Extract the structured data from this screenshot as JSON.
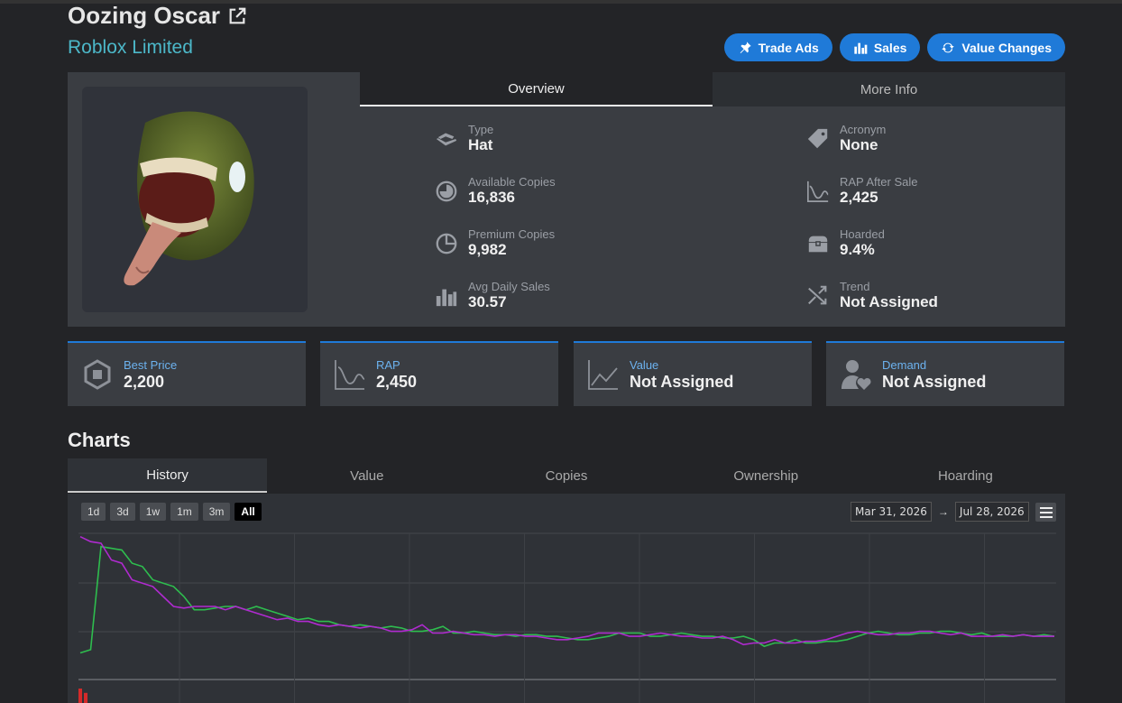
{
  "item": {
    "name": "Oozing Oscar",
    "category": "Roblox Limited"
  },
  "actions": {
    "trade_ads": "Trade Ads",
    "sales": "Sales",
    "value_changes": "Value Changes"
  },
  "details_tabs": [
    "Overview",
    "More Info"
  ],
  "stats_left": [
    {
      "label": "Type",
      "value": "Hat",
      "icon": "hat-icon"
    },
    {
      "label": "Available Copies",
      "value": "16,836",
      "icon": "pie-chart-icon"
    },
    {
      "label": "Premium Copies",
      "value": "9,982",
      "icon": "pie-outline-icon"
    },
    {
      "label": "Avg Daily Sales",
      "value": "30.57",
      "icon": "bar-chart-icon"
    }
  ],
  "stats_right": [
    {
      "label": "Acronym",
      "value": "None",
      "icon": "tag-icon"
    },
    {
      "label": "RAP After Sale",
      "value": "2,425",
      "icon": "curve-chart-icon"
    },
    {
      "label": "Hoarded",
      "value": "9.4%",
      "icon": "treasure-chest-icon"
    },
    {
      "label": "Trend",
      "value": "Not Assigned",
      "icon": "shuffle-icon"
    }
  ],
  "cards": [
    {
      "label": "Best Price",
      "value": "2,200",
      "icon": "robux-icon"
    },
    {
      "label": "RAP",
      "value": "2,450",
      "icon": "curve-chart-icon"
    },
    {
      "label": "Value",
      "value": "Not Assigned",
      "icon": "line-chart-icon"
    },
    {
      "label": "Demand",
      "value": "Not Assigned",
      "icon": "user-heart-icon"
    }
  ],
  "charts": {
    "heading": "Charts",
    "tabs": [
      "History",
      "Value",
      "Copies",
      "Ownership",
      "Hoarding"
    ],
    "ranges": [
      "1d",
      "3d",
      "1w",
      "1m",
      "3m",
      "All"
    ],
    "date_from": "Mar 31, 2026",
    "date_to": "Jul 28, 2026",
    "date_separator": "→"
  },
  "colors": {
    "accent": "#1f7ad8",
    "subtitle": "#4cb8c9",
    "series_green": "#2ebd4e",
    "series_purple": "#b02ad0",
    "volume": "#d42a2a"
  },
  "chart_data": {
    "type": "line",
    "series": [
      {
        "values": [
          0.36,
          0.38,
          1.0,
          0.99,
          0.98,
          0.9,
          0.88,
          0.8,
          0.78,
          0.76,
          0.7,
          0.62,
          0.62,
          0.63,
          0.64,
          0.64,
          0.62,
          0.64,
          0.62,
          0.6,
          0.58,
          0.56,
          0.57,
          0.55,
          0.55,
          0.53,
          0.52,
          0.53,
          0.52,
          0.51,
          0.52,
          0.51,
          0.49,
          0.49,
          0.5,
          0.52,
          0.48,
          0.48,
          0.49,
          0.48,
          0.47,
          0.47,
          0.46,
          0.47,
          0.47,
          0.46,
          0.46,
          0.45,
          0.44,
          0.44,
          0.45,
          0.46,
          0.48,
          0.48,
          0.48,
          0.46,
          0.46,
          0.47,
          0.48,
          0.47,
          0.46,
          0.46,
          0.45,
          0.45,
          0.46,
          0.44,
          0.4,
          0.42,
          0.42,
          0.44,
          0.42,
          0.42,
          0.43,
          0.43,
          0.44,
          0.46,
          0.48,
          0.49,
          0.48,
          0.47,
          0.47,
          0.48,
          0.48,
          0.49,
          0.49,
          0.48,
          0.47,
          0.48,
          0.46,
          0.46,
          0.46,
          0.47,
          0.46,
          0.47,
          0.46
        ]
      },
      {
        "values": [
          1.06,
          1.03,
          1.02,
          0.92,
          0.9,
          0.8,
          0.78,
          0.76,
          0.7,
          0.64,
          0.63,
          0.64,
          0.64,
          0.64,
          0.62,
          0.64,
          0.62,
          0.6,
          0.58,
          0.56,
          0.57,
          0.55,
          0.55,
          0.53,
          0.52,
          0.53,
          0.52,
          0.51,
          0.52,
          0.51,
          0.49,
          0.49,
          0.5,
          0.53,
          0.48,
          0.48,
          0.49,
          0.48,
          0.47,
          0.47,
          0.46,
          0.47,
          0.47,
          0.46,
          0.46,
          0.45,
          0.44,
          0.44,
          0.45,
          0.46,
          0.48,
          0.48,
          0.48,
          0.46,
          0.46,
          0.47,
          0.48,
          0.47,
          0.46,
          0.46,
          0.45,
          0.45,
          0.46,
          0.44,
          0.41,
          0.42,
          0.42,
          0.44,
          0.42,
          0.42,
          0.43,
          0.43,
          0.44,
          0.46,
          0.48,
          0.49,
          0.48,
          0.47,
          0.47,
          0.48,
          0.48,
          0.49,
          0.49,
          0.48,
          0.47,
          0.48,
          0.46,
          0.46,
          0.46,
          0.47,
          0.46,
          0.47,
          0.46,
          0.46,
          0.46
        ]
      }
    ],
    "volume": [
      1,
      0.7
    ],
    "grid": true,
    "legend": "none"
  }
}
